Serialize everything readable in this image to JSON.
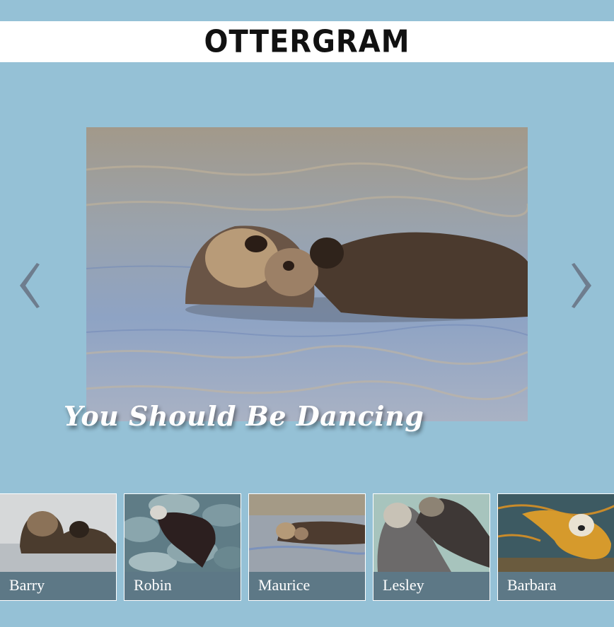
{
  "header": {
    "logo_text": "OTTERGRAM"
  },
  "navigation": {
    "prev_icon": "chevron-left-icon",
    "next_icon": "chevron-right-icon",
    "arrow_color": "#6e7d8e"
  },
  "detail": {
    "title": "You Should Be Dancing"
  },
  "thumbnails": [
    {
      "label": "Barry"
    },
    {
      "label": "Robin"
    },
    {
      "label": "Maurice"
    },
    {
      "label": "Lesley"
    },
    {
      "label": "Barbara"
    }
  ],
  "colors": {
    "background": "#95c1d6",
    "label_bar": "#5d7886"
  }
}
